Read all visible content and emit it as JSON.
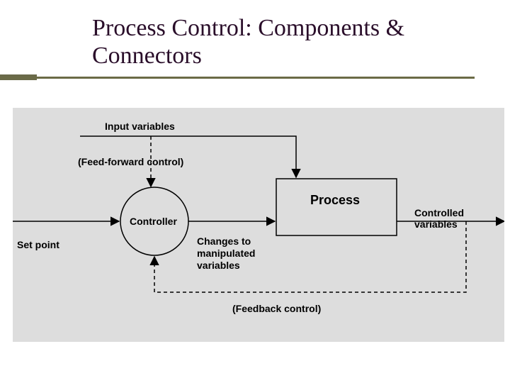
{
  "title": "Process Control: Components & Connectors",
  "labels": {
    "input_variables": "Input variables",
    "feedforward": "(Feed-forward control)",
    "controller": "Controller",
    "process": "Process",
    "controlled_vars": "Controlled variables",
    "set_point": "Set point",
    "changes": "Changes to manipulated variables",
    "feedback": "(Feedback control)"
  }
}
